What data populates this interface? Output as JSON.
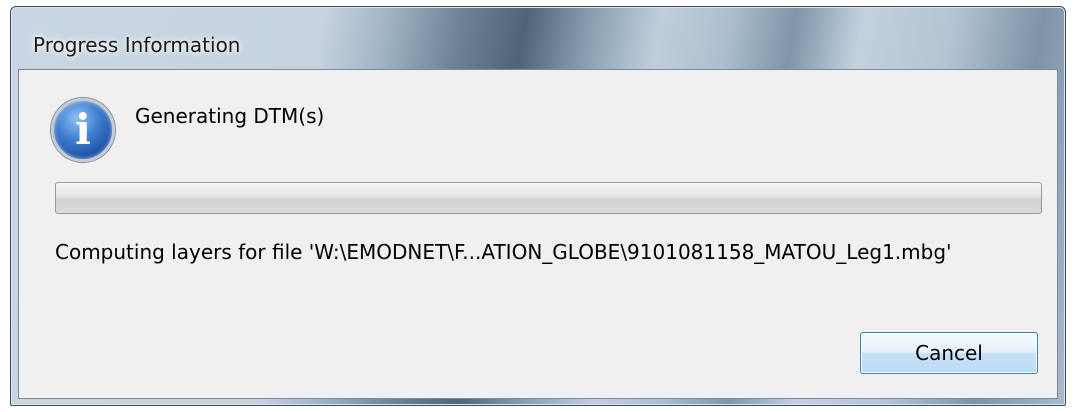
{
  "window": {
    "title": "Progress Information"
  },
  "dialog": {
    "icon": "info-icon",
    "icon_glyph": "i",
    "task_name": "Generating DTM(s)",
    "progress_fraction": 0,
    "sub_task": "Computing layers for file 'W:\\EMODNET\\F...ATION_GLOBE\\9101081158_MATOU_Leg1.mbg'",
    "cancel_label": "Cancel"
  },
  "colors": {
    "button_border": "#3c7fb1",
    "client_background": "#f0f0f0",
    "icon_blue": "#1f4ea8"
  }
}
